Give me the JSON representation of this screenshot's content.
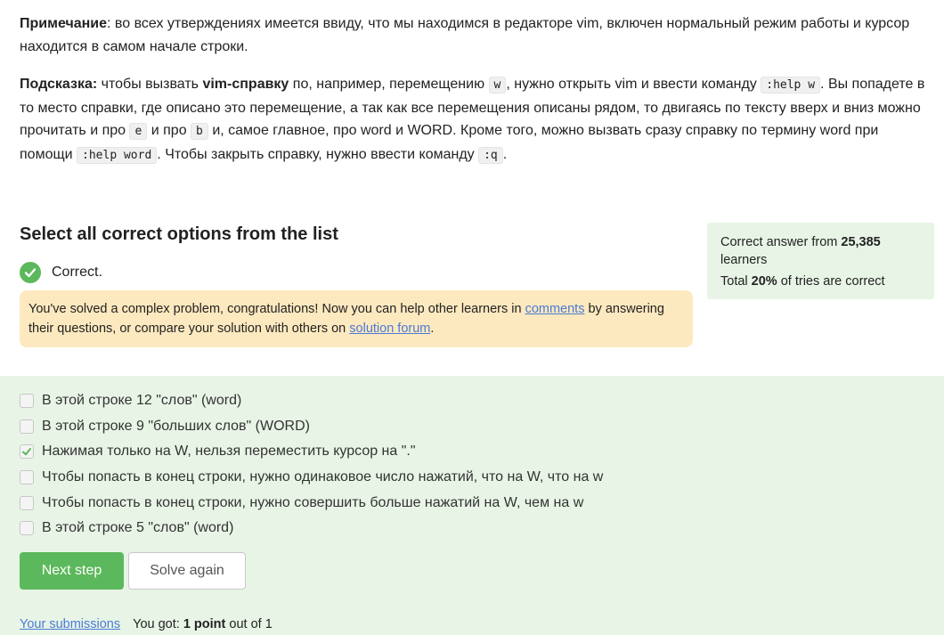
{
  "note": {
    "label": "Примечание",
    "text": ": во всех утверждениях имеется ввиду, что мы находимся в редакторе vim, включен нормальный режим работы и курсор находится в самом начале строки."
  },
  "hint": {
    "label": "Подсказка:",
    "t1": " чтобы вызвать ",
    "bold1": "vim-справку",
    "t2": " по, например, перемещению ",
    "code1": "w",
    "t3": ", нужно открыть vim и ввести команду ",
    "code2": ":help w",
    "t4": ". Вы попадете в то место справки, где описано это перемещение, а так как все перемещения описаны рядом, то двигаясь по тексту вверх и вниз можно прочитать и про ",
    "code3": "e",
    "t5": " и про ",
    "code4": "b",
    "t6": " и, самое главное, про word и WORD. Кроме того, можно вызвать сразу справку по термину word при помощи ",
    "code5": ":help word",
    "t7": ". Чтобы закрыть справку, нужно ввести команду ",
    "code6": ":q",
    "t8": "."
  },
  "question": {
    "title": "Select all correct options from the list",
    "status": "Correct."
  },
  "congrats": {
    "t1": "You've solved a complex problem, congratulations! Now you can help other learners in ",
    "link1": "comments",
    "t2": " by answering their questions, or compare your solution with others on ",
    "link2": "solution forum",
    "t3": "."
  },
  "stats": {
    "prefix": "Correct answer from ",
    "learners_count": "25,385",
    "learners_label": " learners",
    "total_prefix": "Total ",
    "percent": "20%",
    "total_suffix": " of tries are correct"
  },
  "options": [
    {
      "text": "В этой строке 12 \"слов\" (word)",
      "checked": false
    },
    {
      "text": "В этой строке 9 \"больших слов\" (WORD)",
      "checked": false
    },
    {
      "text": "Нажимая только на W, нельзя переместить курсор на \".\"",
      "checked": true
    },
    {
      "text": "Чтобы попасть в конец строки, нужно одинаковое число нажатий, что на W, что на w",
      "checked": false
    },
    {
      "text": "Чтобы попасть в конец строки, нужно совершить больше нажатий на W, чем на w",
      "checked": false
    },
    {
      "text": "В этой строке 5 \"слов\" (word)",
      "checked": false
    }
  ],
  "buttons": {
    "next": "Next step",
    "again": "Solve again"
  },
  "footer": {
    "submissions": "Your submissions",
    "got_prefix": "You got: ",
    "points": "1 point",
    "got_suffix": " out of 1"
  },
  "colors": {
    "accent_green": "#5cb85c",
    "panel_green": "#e8f5e6",
    "congrats_bg": "#fde9bf",
    "link": "#4a7ad6"
  }
}
